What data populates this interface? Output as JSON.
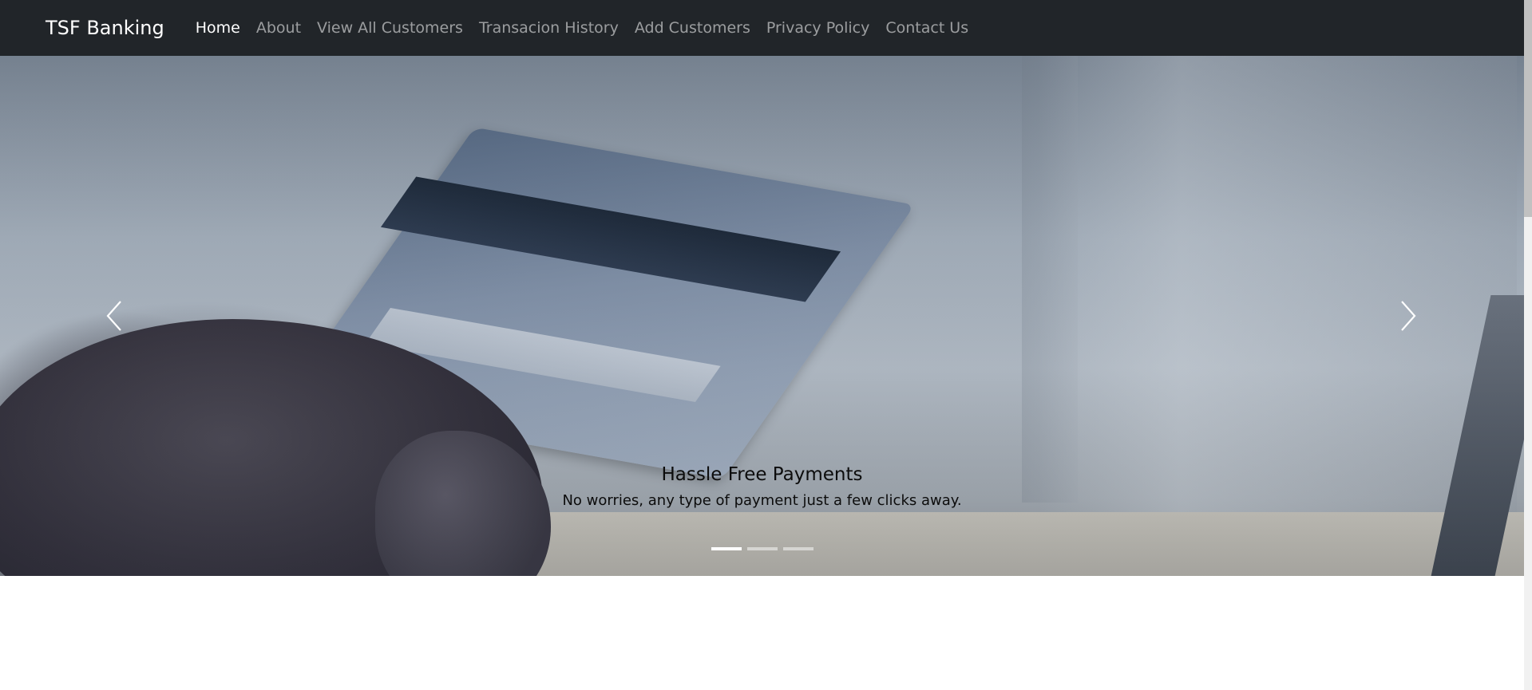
{
  "navbar": {
    "brand": "TSF Banking",
    "links": [
      {
        "label": "Home",
        "active": true
      },
      {
        "label": "About",
        "active": false
      },
      {
        "label": "View All Customers",
        "active": false
      },
      {
        "label": "Transacion History",
        "active": false
      },
      {
        "label": "Add Customers",
        "active": false
      },
      {
        "label": "Privacy Policy",
        "active": false
      },
      {
        "label": "Contact Us",
        "active": false
      }
    ]
  },
  "carousel": {
    "caption_title": "Hassle Free Payments",
    "caption_text": "No worries, any type of payment just a few clicks away.",
    "slide_count": 3,
    "active_slide": 1,
    "prev_icon": "chevron-left-icon",
    "next_icon": "chevron-right-icon"
  },
  "colors": {
    "navbar_bg": "#212529",
    "nav_active": "#ffffff",
    "nav_inactive": "rgba(255,255,255,0.55)"
  }
}
